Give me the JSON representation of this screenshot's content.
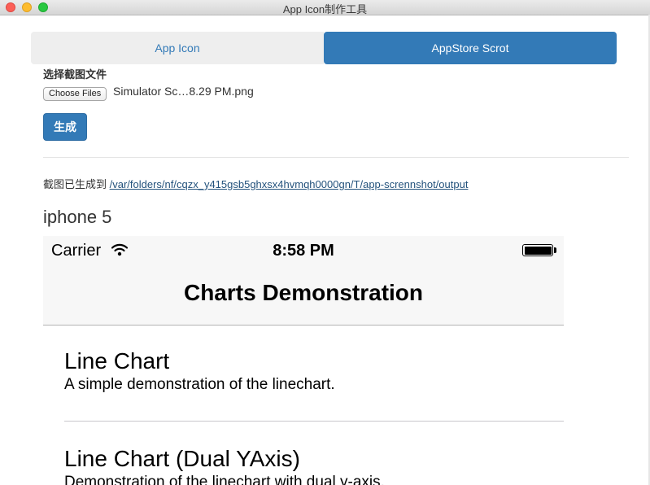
{
  "window": {
    "title": "App Icon制作工具"
  },
  "tabs": [
    {
      "label": "App Icon",
      "active": false
    },
    {
      "label": "AppStore Scrot",
      "active": true
    }
  ],
  "form": {
    "file_label": "选择截图文件",
    "choose_files_label": "Choose Files",
    "file_name": "Simulator Sc…8.29 PM.png",
    "generate_label": "生成"
  },
  "output": {
    "prefix": "截图已生成到 ",
    "path": "/var/folders/nf/cqzx_y415gsb5ghxsx4hvmqh0000gn/T/app-scrennshot/output"
  },
  "device": {
    "name": "iphone 5",
    "status_bar": {
      "carrier": "Carrier",
      "time": "8:58 PM"
    },
    "nav_title": "Charts Demonstration",
    "list": [
      {
        "title": "Line Chart",
        "subtitle": "A simple demonstration of the linechart."
      },
      {
        "title": "Line Chart (Dual YAxis)",
        "subtitle": "Demonstration of the linechart with dual y-axis."
      }
    ]
  },
  "colors": {
    "accent": "#337ab7",
    "link": "#23527c"
  }
}
